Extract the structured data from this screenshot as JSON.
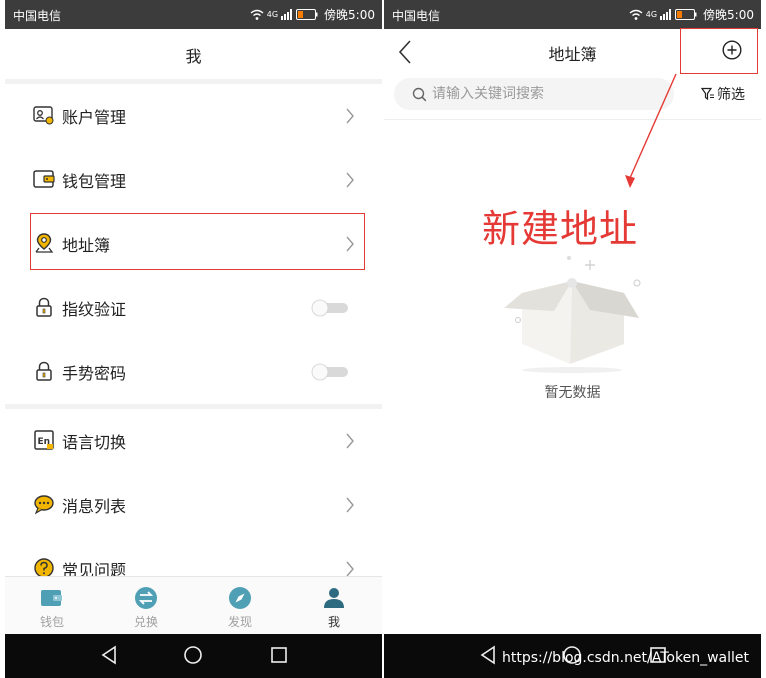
{
  "status_bar": {
    "carrier": "中国电信",
    "time": "傍晚5:00",
    "network": "4G"
  },
  "left_screen": {
    "title": "我",
    "menu": [
      {
        "label": "账户管理",
        "icon": "account-card-icon",
        "control": "chevron"
      },
      {
        "label": "钱包管理",
        "icon": "wallet-icon",
        "control": "chevron"
      },
      {
        "label": "地址簿",
        "icon": "location-pin-icon",
        "control": "chevron"
      },
      {
        "label": "指纹验证",
        "icon": "lock-icon",
        "control": "toggle",
        "enabled": false
      },
      {
        "label": "手势密码",
        "icon": "lock-icon",
        "control": "toggle",
        "enabled": false
      },
      {
        "label": "语言切换",
        "icon": "language-en-icon",
        "control": "chevron"
      },
      {
        "label": "消息列表",
        "icon": "chat-bubble-icon",
        "control": "chevron"
      },
      {
        "label": "常见问题",
        "icon": "question-icon",
        "control": "chevron"
      }
    ],
    "tabs": [
      {
        "label": "钱包",
        "icon": "wallet-tab-icon",
        "active": false
      },
      {
        "label": "兑换",
        "icon": "exchange-icon",
        "active": false
      },
      {
        "label": "发现",
        "icon": "compass-icon",
        "active": false
      },
      {
        "label": "我",
        "icon": "person-icon",
        "active": true
      }
    ]
  },
  "right_screen": {
    "title": "地址簿",
    "search_placeholder": "请输入关键词搜索",
    "search_value": "",
    "filter_label": "筛选",
    "annotation": "新建地址",
    "empty_text": "暂无数据"
  },
  "watermark": "https://blog.csdn.net/AToken_wallet",
  "colors": {
    "accent_red": "#e53935",
    "status_bar": "#3c3c3c",
    "nav_bar": "#0a0a0a",
    "tab_icon_teal": "#4f9fb5",
    "icon_yellow": "#f2b600"
  }
}
